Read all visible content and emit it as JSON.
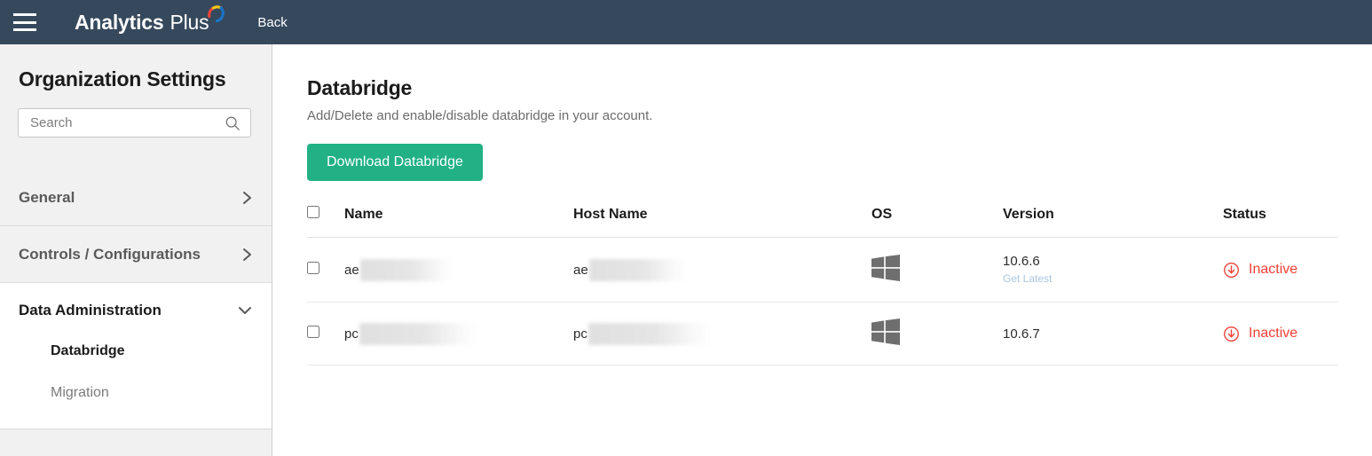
{
  "topbar": {
    "menu_icon": "hamburger-icon",
    "brand_primary": "Analytics",
    "brand_secondary": "Plus",
    "brand_arc_colors": [
      "#e8443a",
      "#f5c518",
      "#1a73c8"
    ],
    "back_label": "Back",
    "background": "#36495c"
  },
  "sidebar": {
    "title": "Organization Settings",
    "search": {
      "placeholder": "Search",
      "value": "",
      "icon": "search-icon"
    },
    "sections": [
      {
        "label": "General",
        "expanded": false,
        "chevron": "chevron-right-icon"
      },
      {
        "label": "Controls / Configurations",
        "expanded": false,
        "chevron": "chevron-right-icon"
      },
      {
        "label": "Data Administration",
        "expanded": true,
        "chevron": "chevron-down-icon"
      }
    ],
    "data_administration_items": [
      {
        "label": "Databridge",
        "active": true
      },
      {
        "label": "Migration",
        "active": false
      }
    ]
  },
  "main": {
    "title": "Databridge",
    "subtitle": "Add/Delete and enable/disable databridge in your account.",
    "download_button": "Download Databridge",
    "accent_color": "#21b185",
    "table": {
      "columns": [
        "Name",
        "Host Name",
        "OS",
        "Version",
        "Status"
      ],
      "select_all_checked": false,
      "rows": [
        {
          "checked": false,
          "name_prefix": "ae",
          "name_redacted": true,
          "host_prefix": "ae",
          "host_redacted": true,
          "os": "windows-icon",
          "version": "10.6.6",
          "get_latest_label": "Get Latest",
          "status": "Inactive",
          "status_icon": "download-circle-icon",
          "status_color": "#ef4036"
        },
        {
          "checked": false,
          "name_prefix": "pc",
          "name_redacted": true,
          "host_prefix": "pc",
          "host_redacted": true,
          "os": "windows-icon",
          "version": "10.6.7",
          "get_latest_label": "",
          "status": "Inactive",
          "status_icon": "download-circle-icon",
          "status_color": "#ef4036"
        }
      ]
    }
  }
}
